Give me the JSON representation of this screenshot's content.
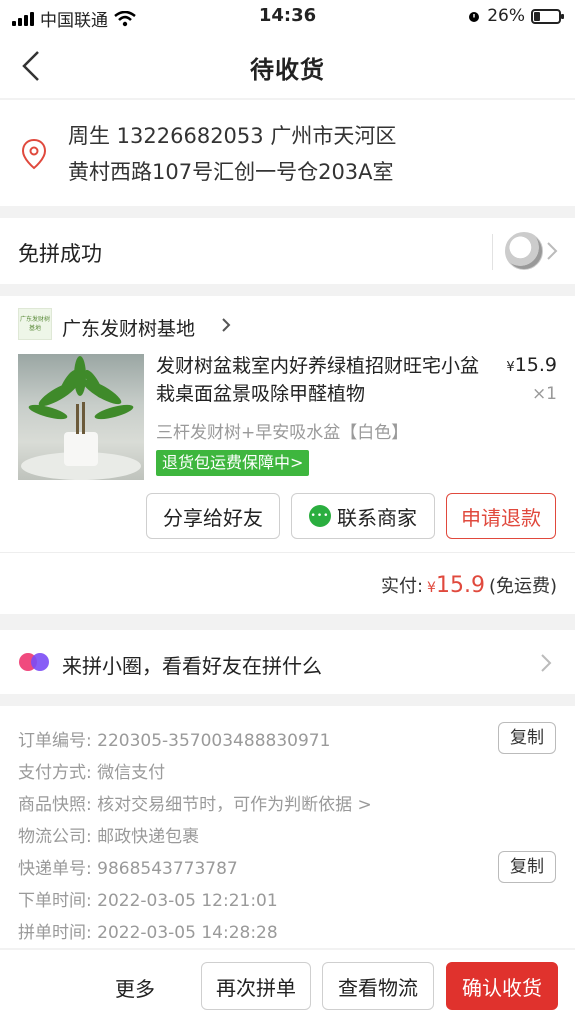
{
  "status_bar": {
    "carrier": "中国联通",
    "time": "14:36",
    "battery": "26%",
    "battery_level": 0.26
  },
  "nav": {
    "title": "待收货"
  },
  "address": {
    "line1": "周生  13226682053  广州市天河区",
    "line2": "黄村西路107号汇创一号仓203A室"
  },
  "group": {
    "status": "免拼成功"
  },
  "shop": {
    "logo_text": "广东发财树基地",
    "name": "广东发财树基地"
  },
  "product": {
    "name": "发财树盆栽室内好养绿植招财旺宅小盆栽桌面盆景吸除甲醛植物",
    "currency": "¥",
    "price": "15.9",
    "quantity": "×1",
    "spec": "三杆发财树+早安吸水盆【白色】",
    "guarantee": "退货包运费保障中>"
  },
  "actions": {
    "share": "分享给好友",
    "contact": "联系商家",
    "refund": "申请退款"
  },
  "payment": {
    "label": "实付:",
    "currency": "¥",
    "amount": "15.9",
    "note": "(免运费)"
  },
  "circle": {
    "text": "来拼小圈，看看好友在拼什么"
  },
  "order_info": {
    "order_no": "订单编号:  220305-357003488830971",
    "pay_method": "支付方式:  微信支付",
    "snapshot": "商品快照:  核对交易细节时，可作为判断依据 >",
    "courier": "物流公司:  邮政快递包裹",
    "tracking": "快递单号:  9868543773787",
    "order_time": "下单时间:  2022-03-05 12:21:01",
    "group_time": "拼单时间:  2022-03-05 14:28:28",
    "copy": "复制"
  },
  "bottom": {
    "more": "更多",
    "again": "再次拼单",
    "logistics": "查看物流",
    "confirm": "确认收货"
  },
  "colors": {
    "accent": "#e0322d",
    "green": "#3eb63e"
  }
}
